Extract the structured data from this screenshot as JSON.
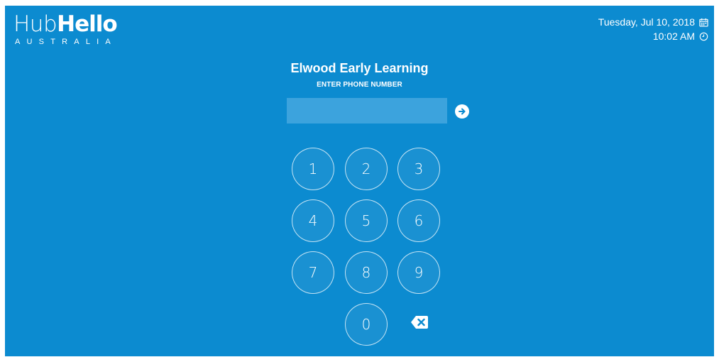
{
  "logo": {
    "hub": "Hub",
    "hello": "Hello",
    "subtitle": "AUSTRALIA"
  },
  "datetime": {
    "date": "Tuesday, Jul 10, 2018",
    "time": "10:02 AM",
    "date_icon": "calendar-icon",
    "time_icon": "clock-icon"
  },
  "main": {
    "title": "Elwood Early Learning",
    "instruction": "ENTER PHONE NUMBER",
    "phone_value": "",
    "submit_icon": "arrow-right-circle-icon"
  },
  "keypad": {
    "keys": [
      "1",
      "2",
      "3",
      "4",
      "5",
      "6",
      "7",
      "8",
      "9",
      "0"
    ],
    "backspace_icon": "backspace-icon"
  },
  "colors": {
    "background": "#0c8bd0",
    "input_background": "#3ca3dd",
    "text": "#ffffff"
  }
}
